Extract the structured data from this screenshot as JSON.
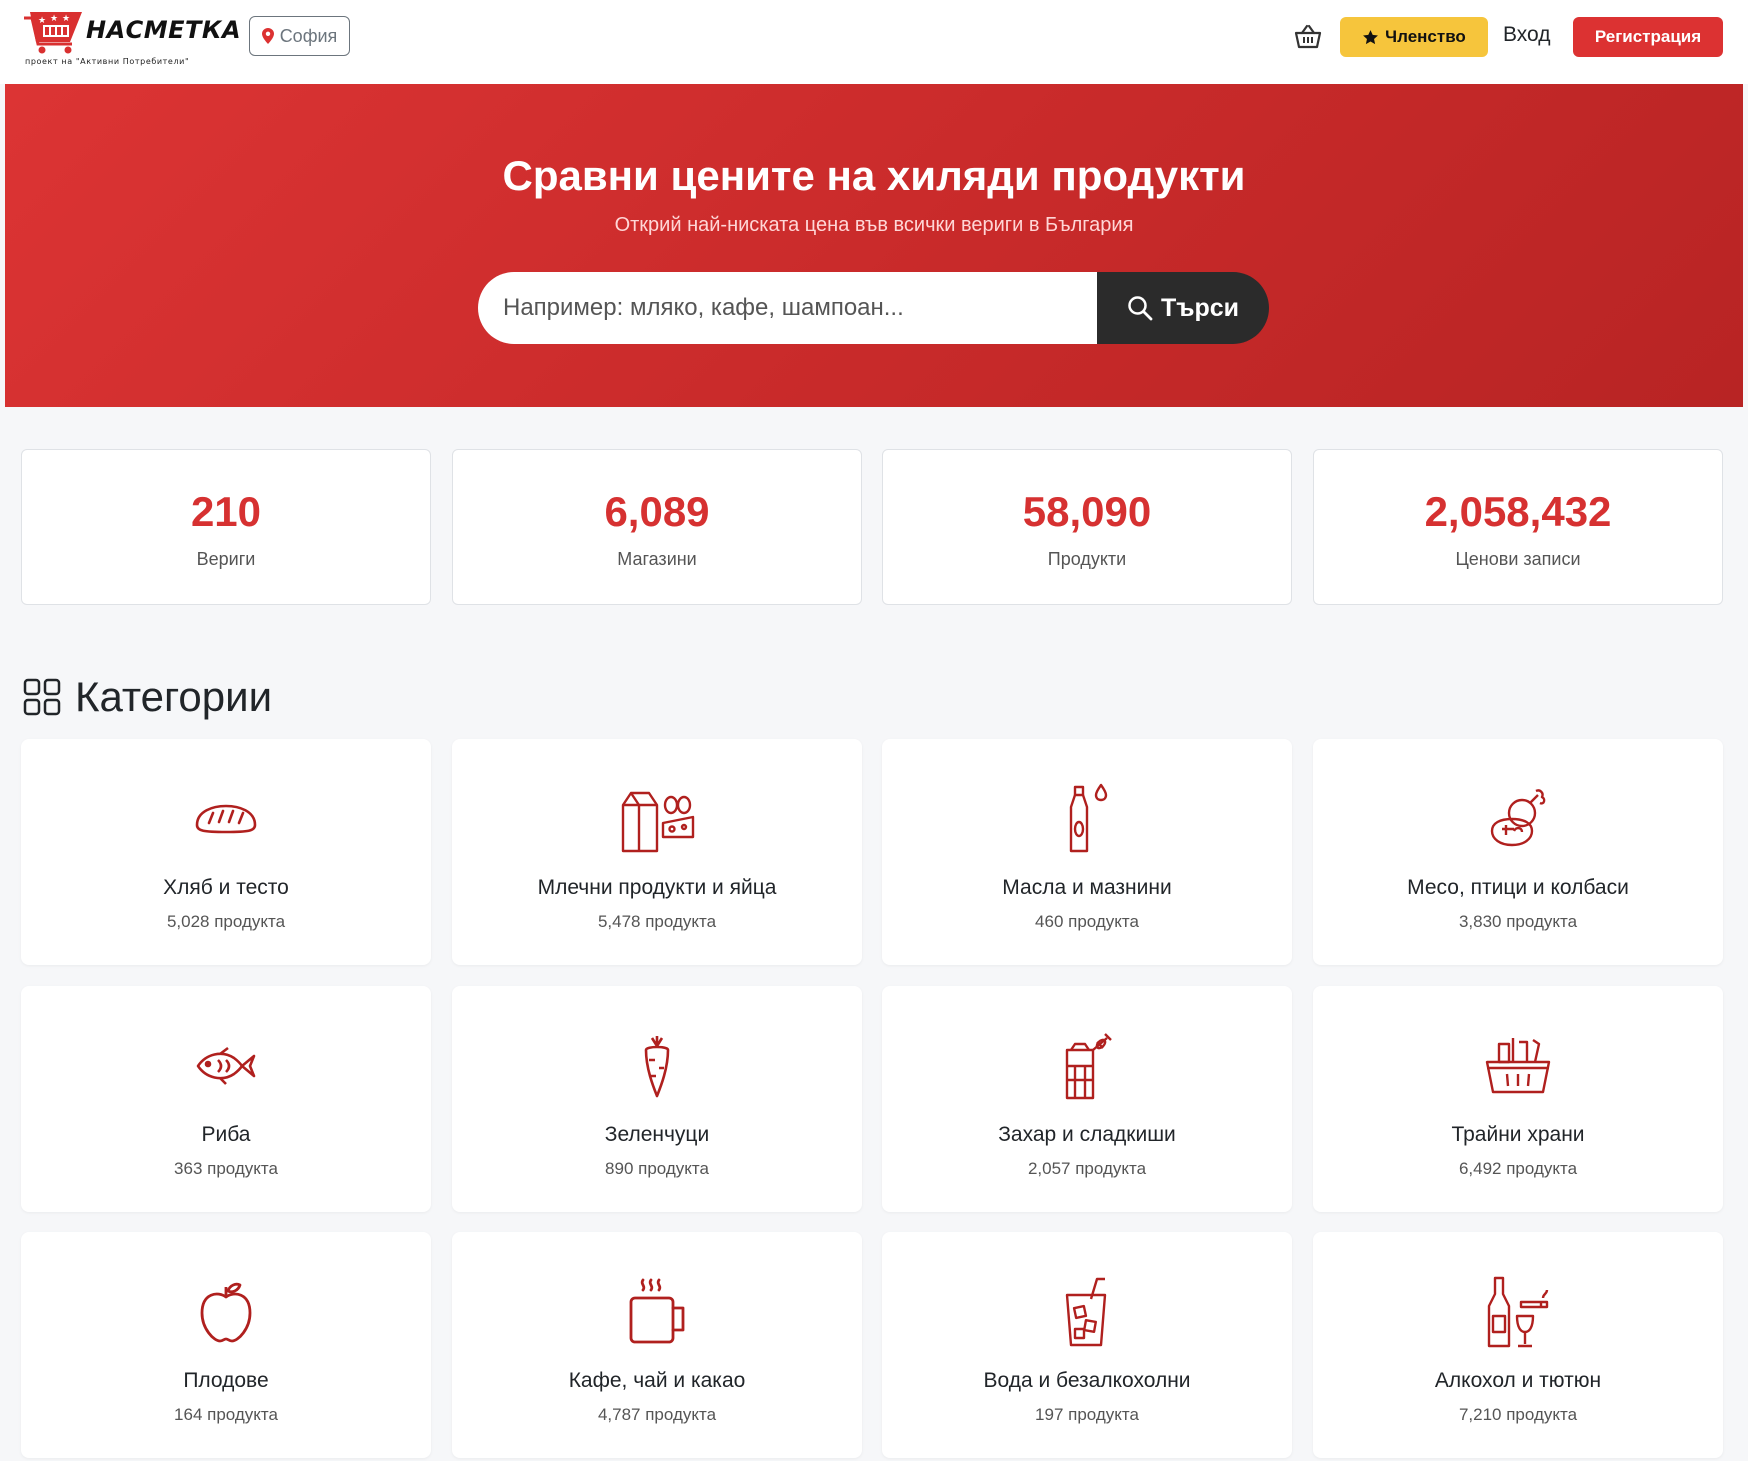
{
  "header": {
    "logo_name": "НАСМЕТКА",
    "logo_tagline": "проект на \"Активни Потребители\"",
    "city": "София",
    "membership_label": "Членство",
    "login_label": "Вход",
    "register_label": "Регистрация"
  },
  "hero": {
    "title": "Сравни цените на хиляди продукти",
    "subtitle": "Открий най-ниската цена във всички вериги в България",
    "search_placeholder": "Например: мляко, кафе, шампоан...",
    "search_button": "Търси"
  },
  "stats": [
    {
      "value": "210",
      "label": "Вериги"
    },
    {
      "value": "6,089",
      "label": "Магазини"
    },
    {
      "value": "58,090",
      "label": "Продукти"
    },
    {
      "value": "2,058,432",
      "label": "Ценови записи"
    }
  ],
  "categories_title": "Категории",
  "categories": [
    {
      "name": "Хляб и тесто",
      "count": "5,028 продукта",
      "icon": "bread-icon"
    },
    {
      "name": "Млечни продукти и яйца",
      "count": "5,478 продукта",
      "icon": "dairy-icon"
    },
    {
      "name": "Масла и мазнини",
      "count": "460 продукта",
      "icon": "oil-bottle-icon"
    },
    {
      "name": "Месо, птици и колбаси",
      "count": "3,830 продукта",
      "icon": "meat-icon"
    },
    {
      "name": "Риба",
      "count": "363 продукта",
      "icon": "fish-icon"
    },
    {
      "name": "Зеленчуци",
      "count": "890 продукта",
      "icon": "carrot-icon"
    },
    {
      "name": "Захар и сладкиши",
      "count": "2,057 продукта",
      "icon": "sweets-icon"
    },
    {
      "name": "Трайни храни",
      "count": "6,492 продукта",
      "icon": "grocery-basket-icon"
    },
    {
      "name": "Плодове",
      "count": "164 продукта",
      "icon": "apple-icon"
    },
    {
      "name": "Кафе, чай и какао",
      "count": "4,787 продукта",
      "icon": "hot-mug-icon"
    },
    {
      "name": "Вода и безалкохолни",
      "count": "197 продукта",
      "icon": "soft-drink-icon"
    },
    {
      "name": "Алкохол и тютюн",
      "count": "7,210 продукта",
      "icon": "alcohol-tobacco-icon"
    }
  ],
  "colors": {
    "brand_red": "#dc3232",
    "accent_yellow": "#f6c53c",
    "stat_red": "#d63131",
    "icon_red": "#b0201e"
  }
}
